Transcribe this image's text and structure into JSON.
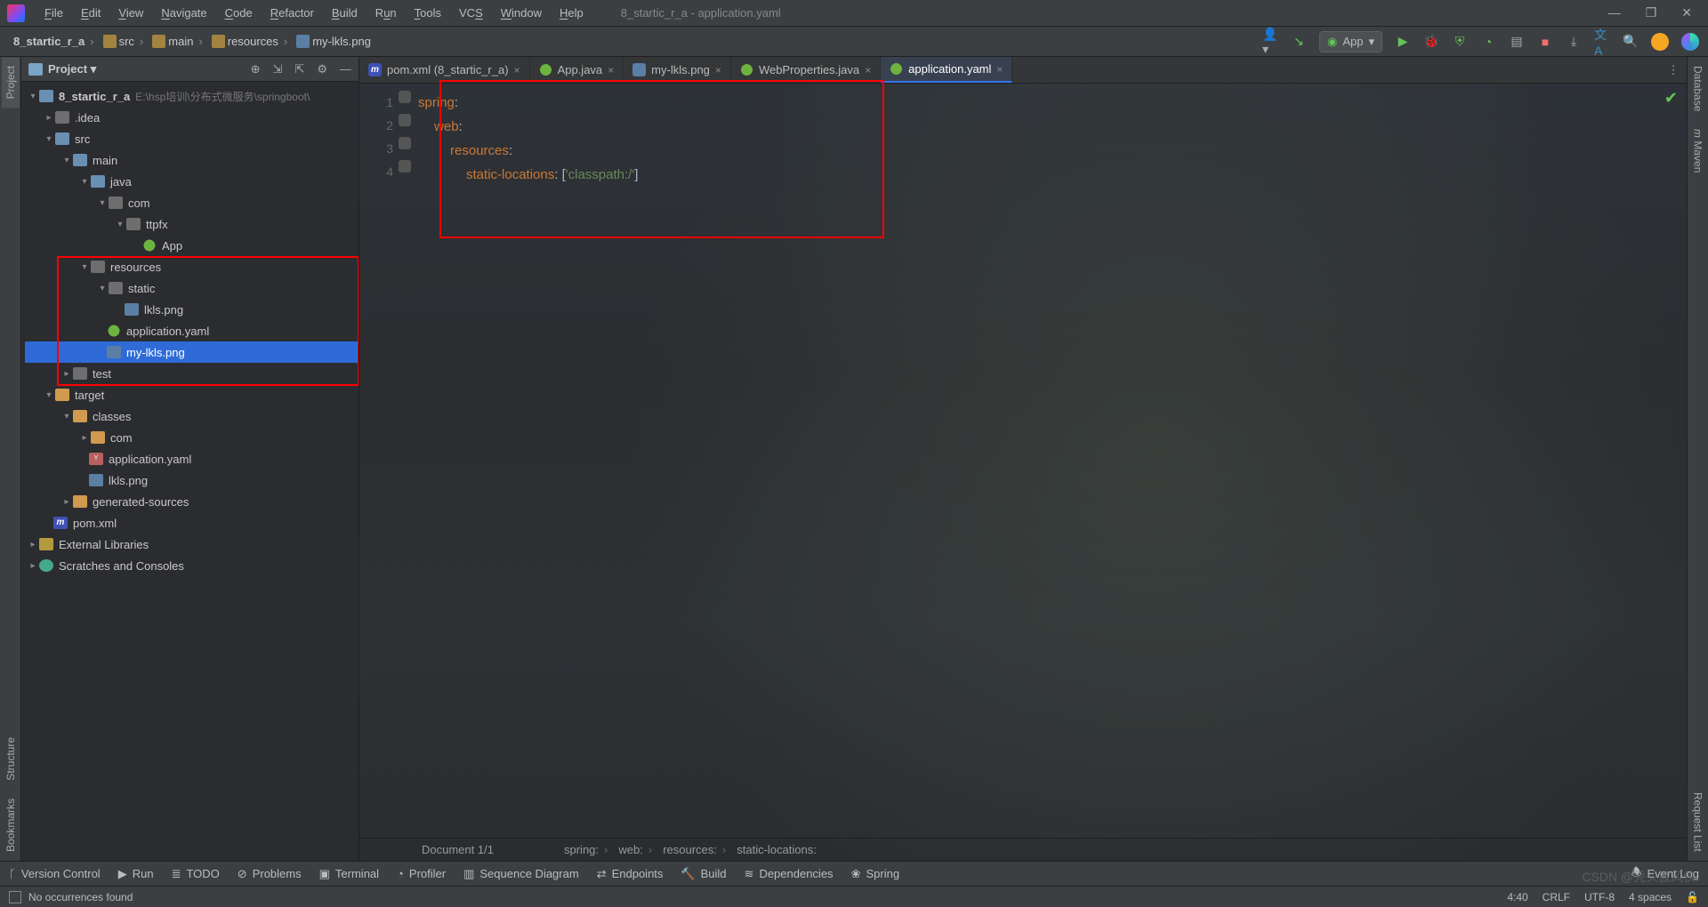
{
  "window": {
    "title": "8_startic_r_a - application.yaml",
    "minimize": "—",
    "maximize": "❐",
    "close": "✕"
  },
  "menu": {
    "file": "File",
    "edit": "Edit",
    "view": "View",
    "navigate": "Navigate",
    "code": "Code",
    "refactor": "Refactor",
    "build": "Build",
    "run": "Run",
    "tools": "Tools",
    "vcs": "VCS",
    "window": "Window",
    "help": "Help"
  },
  "breadcrumbs": [
    "8_startic_r_a",
    "src",
    "main",
    "resources",
    "my-lkls.png"
  ],
  "runConfig": {
    "label": "App"
  },
  "leftGutterTabs": [
    "Project",
    "Structure",
    "Bookmarks"
  ],
  "rightGutterTabs": [
    "Database",
    "Maven",
    "Request List"
  ],
  "projectPanel": {
    "title": "Project",
    "rootHint": "E:\\hsp培训\\分布式微服务\\springboot\\",
    "nodes": {
      "root": "8_startic_r_a",
      "idea": ".idea",
      "src": "src",
      "main": "main",
      "java": "java",
      "com": "com",
      "ttpfx": "ttpfx",
      "app": "App",
      "resources": "resources",
      "static": "static",
      "lkls": "lkls.png",
      "appyaml": "application.yaml",
      "mylkls": "my-lkls.png",
      "test": "test",
      "target": "target",
      "classes": "classes",
      "com2": "com",
      "appyaml2": "application.yaml",
      "lkls2": "lkls.png",
      "gensrc": "generated-sources",
      "pom": "pom.xml",
      "extlib": "External Libraries",
      "scratch": "Scratches and Consoles"
    }
  },
  "tabs": [
    {
      "icon": "m",
      "label": "pom.xml (8_startic_r_a)"
    },
    {
      "icon": "sp",
      "label": "App.java"
    },
    {
      "icon": "im",
      "label": "my-lkls.png"
    },
    {
      "icon": "sp",
      "label": "WebProperties.java"
    },
    {
      "icon": "sp",
      "label": "application.yaml",
      "active": true
    }
  ],
  "code": {
    "lines": [
      "1",
      "2",
      "3",
      "4"
    ],
    "l1": {
      "k": "spring",
      "c": ":"
    },
    "l2": {
      "k": "web",
      "c": ":"
    },
    "l3": {
      "k": "resources",
      "c": ":"
    },
    "l4": {
      "k": "static-locations",
      "c": ": ",
      "b1": "[",
      "s": "'classpath:/'",
      "b2": "]"
    }
  },
  "editorCrumbs": {
    "doc": "Document 1/1",
    "path": [
      "spring:",
      "web:",
      "resources:",
      "static-locations:"
    ]
  },
  "bottomTools": {
    "vcs": "Version Control",
    "run": "Run",
    "todo": "TODO",
    "problems": "Problems",
    "terminal": "Terminal",
    "profiler": "Profiler",
    "seq": "Sequence Diagram",
    "endpoints": "Endpoints",
    "build": "Build",
    "deps": "Dependencies",
    "spring": "Spring",
    "eventlog": "Event Log"
  },
  "status": {
    "msg": "No occurrences found",
    "pos": "4:40",
    "le": "CRLF",
    "enc": "UTF-8",
    "indent": "4 spaces"
  },
  "watermark": "CSDN @秃头披风侠."
}
